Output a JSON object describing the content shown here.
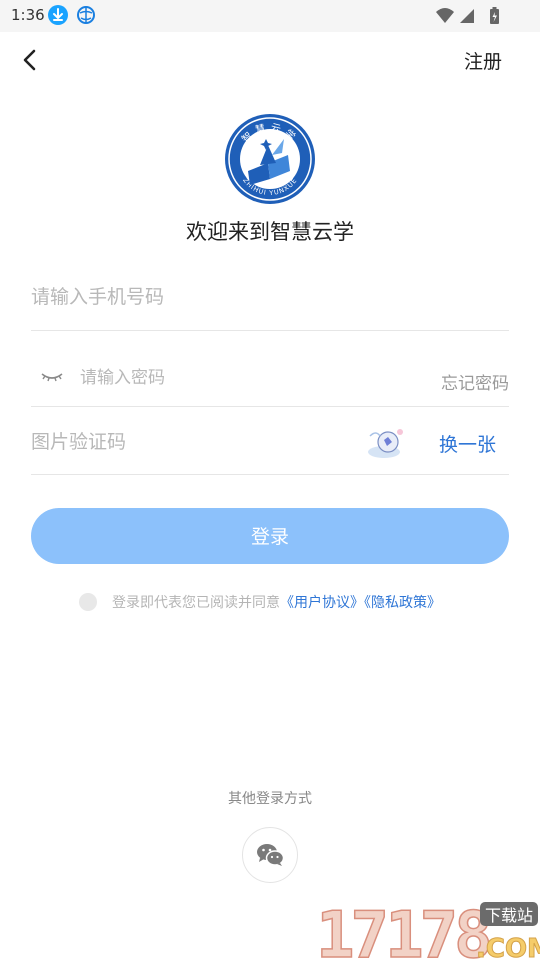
{
  "status_bar": {
    "time": "1:36"
  },
  "header": {
    "register_label": "注册"
  },
  "welcome_title": "欢迎来到智慧云学",
  "logo": {
    "top_text": "智慧云学",
    "bottom_text": "ZHIHUI YUNXUE"
  },
  "form": {
    "phone_placeholder": "请输入手机号码",
    "password_placeholder": "请输入密码",
    "forgot_label": "忘记密码",
    "captcha_placeholder": "图片验证码",
    "change_captcha_label": "换一张",
    "login_label": "登录"
  },
  "agreement": {
    "prefix": "登录即代表您已阅读并同意",
    "user_agreement": "《用户协议》",
    "privacy_policy": "《隐私政策》"
  },
  "other_login": {
    "label": "其他登录方式"
  },
  "watermark": {
    "number": "17178",
    "tag": "下载站",
    "suffix": ".COM"
  },
  "colors": {
    "accent": "#2f76d6",
    "login_button": "#8cc1fb",
    "logo_blue": "#1f5fb8"
  }
}
